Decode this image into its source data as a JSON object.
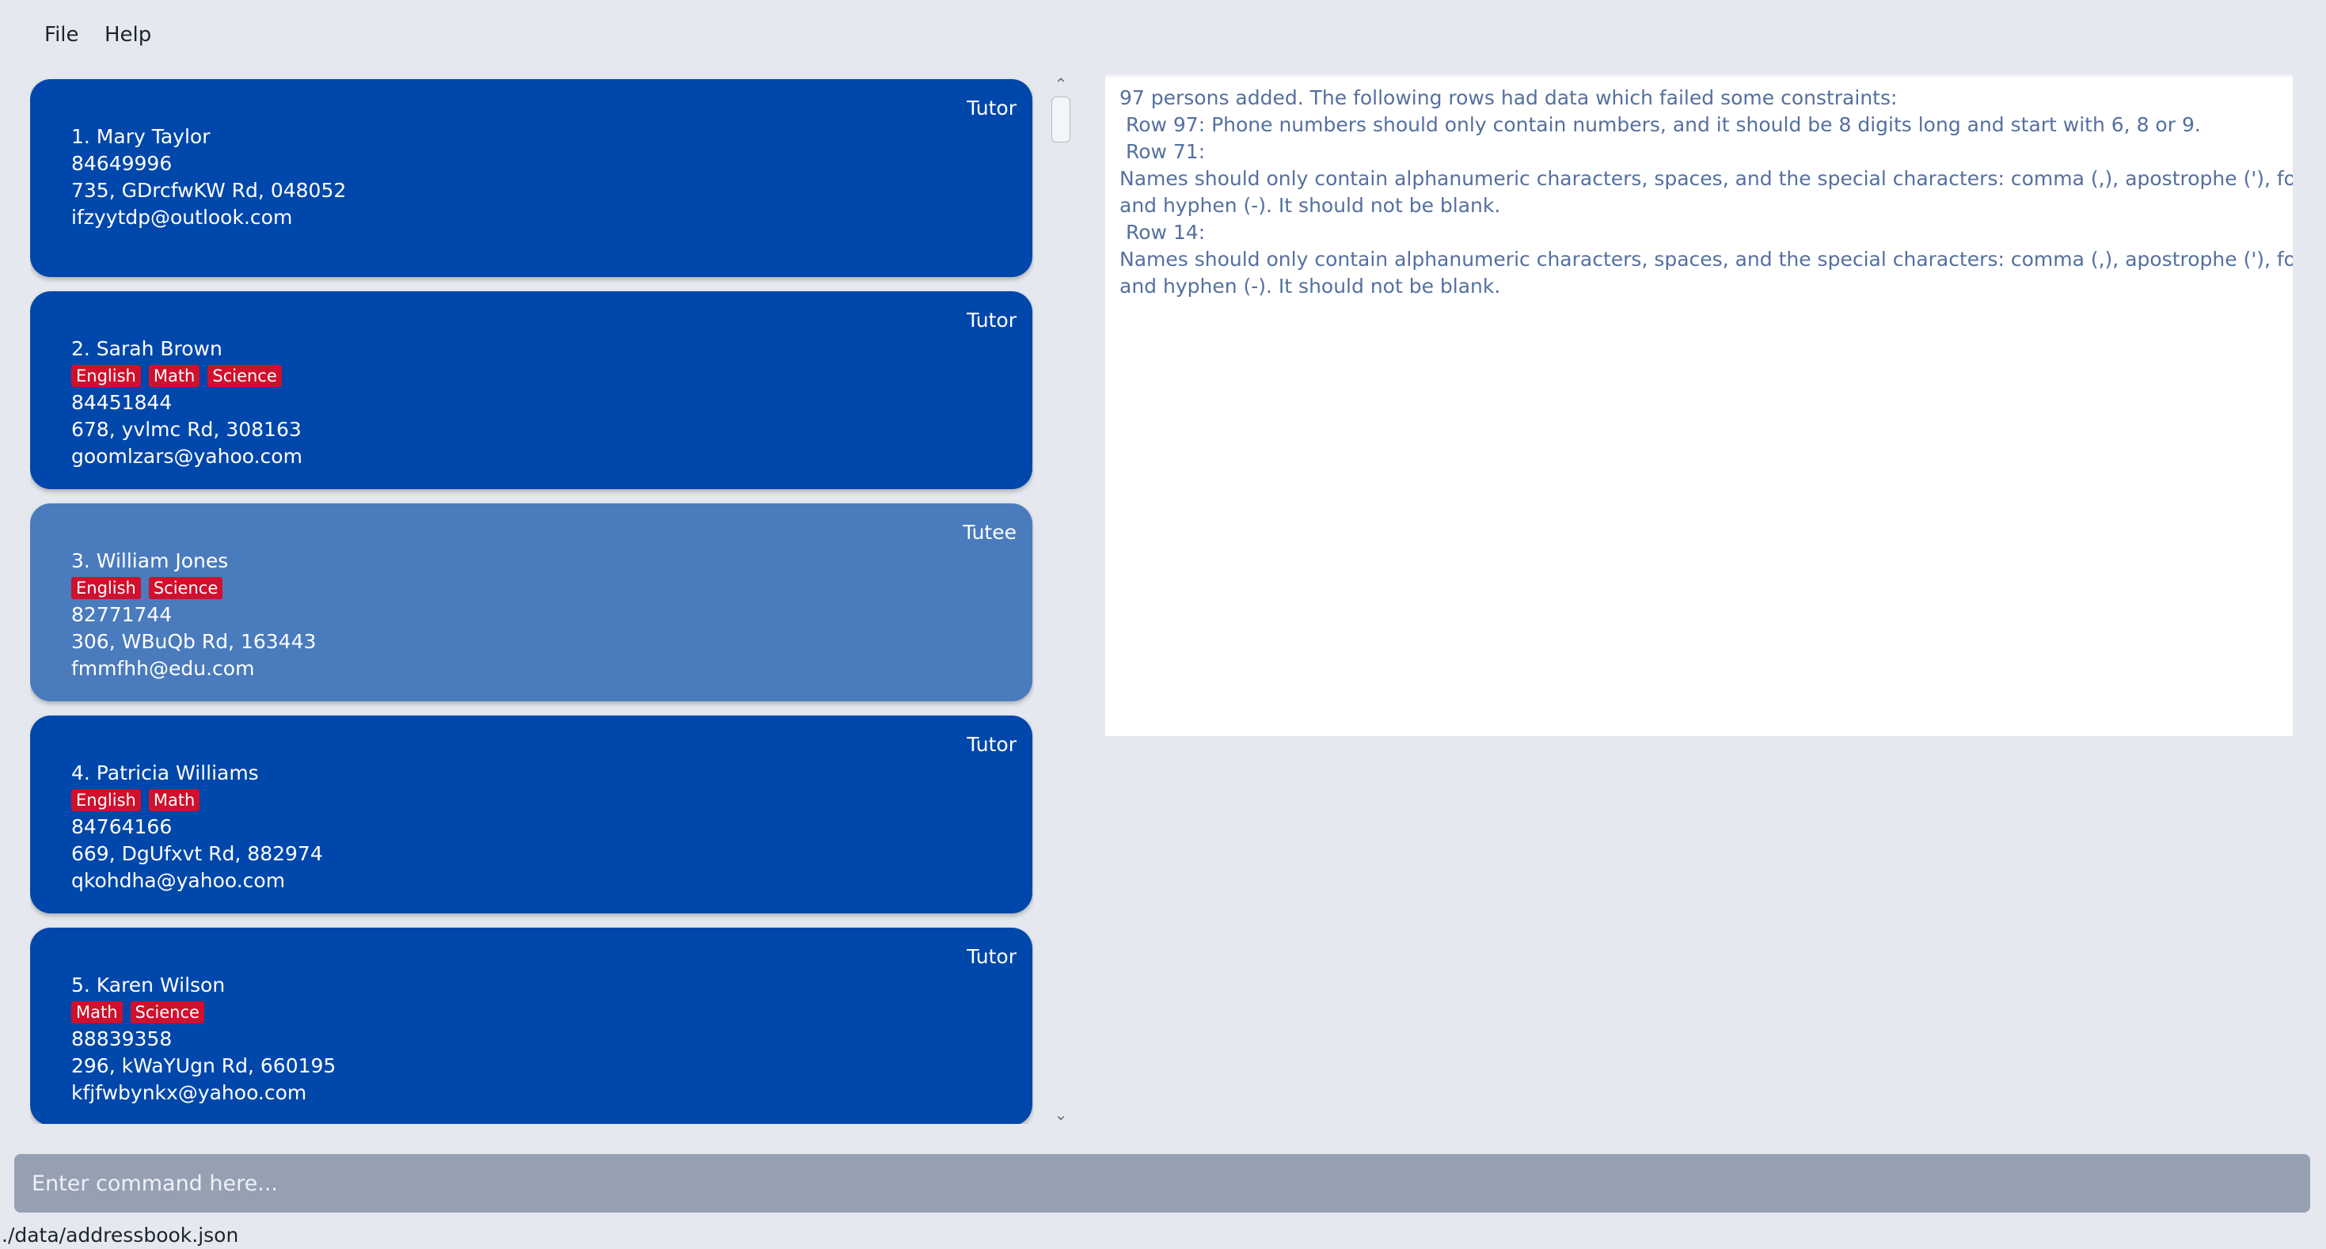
{
  "menu": {
    "file": "File",
    "help": "Help"
  },
  "persons": [
    {
      "index_name": "1. Mary Taylor",
      "role": "Tutor",
      "tags": [],
      "phone": "84649996",
      "address": "735, GDrcfwKW Rd, 048052",
      "email": "ifzyytdp@outlook.com",
      "selected": false
    },
    {
      "index_name": "2. Sarah Brown",
      "role": "Tutor",
      "tags": [
        "English",
        "Math",
        "Science"
      ],
      "phone": "84451844",
      "address": "678, yvlmc Rd, 308163",
      "email": "goomlzars@yahoo.com",
      "selected": false
    },
    {
      "index_name": "3. William Jones",
      "role": "Tutee",
      "tags": [
        "English",
        "Science"
      ],
      "phone": "82771744",
      "address": "306, WBuQb Rd, 163443",
      "email": "fmmfhh@edu.com",
      "selected": true
    },
    {
      "index_name": "4. Patricia Williams",
      "role": "Tutor",
      "tags": [
        "English",
        "Math"
      ],
      "phone": "84764166",
      "address": "669, DgUfxvt Rd, 882974",
      "email": "qkohdha@yahoo.com",
      "selected": false
    },
    {
      "index_name": "5. Karen Wilson",
      "role": "Tutor",
      "tags": [
        "Math",
        "Science"
      ],
      "phone": "88839358",
      "address": "296, kWaYUgn Rd, 660195",
      "email": "kfjfwbynkx@yahoo.com",
      "selected": false
    }
  ],
  "scrollbar": {
    "up_arrow": "⌃",
    "down_arrow": "⌄"
  },
  "result": {
    "lines": [
      "97 persons added. The following rows had data which failed some constraints:",
      " Row 97: Phone numbers should only contain numbers, and it should be 8 digits long and start with 6, 8 or 9.",
      " Row 71:",
      "Names should only contain alphanumeric characters, spaces, and the special characters: comma (,), apostrophe ('), forward slash (/),",
      "and hyphen (-). It should not be blank.",
      " Row 14:",
      "Names should only contain alphanumeric characters, spaces, and the special characters: comma (,), apostrophe ('), forward slash (/),",
      "and hyphen (-). It should not be blank."
    ]
  },
  "command": {
    "placeholder": "Enter command here...",
    "value": ""
  },
  "status": {
    "path": "./data/addressbook.json"
  }
}
